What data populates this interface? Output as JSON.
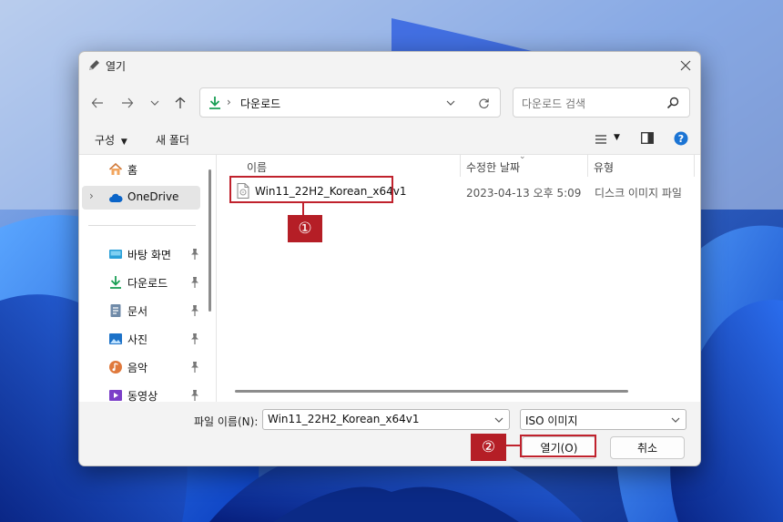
{
  "dialog": {
    "title": "열기"
  },
  "navigation": {
    "address_path": "다운로드",
    "search_placeholder": "다운로드 검색"
  },
  "commandbar": {
    "organize_label": "구성",
    "new_folder_label": "새 폴더"
  },
  "sidebar": {
    "items": [
      {
        "label": "홈",
        "icon": "home-icon"
      },
      {
        "label": "OneDrive",
        "icon": "cloud-icon"
      },
      {
        "label": "바탕 화면",
        "icon": "desktop-icon"
      },
      {
        "label": "다운로드",
        "icon": "download-icon"
      },
      {
        "label": "문서",
        "icon": "document-icon"
      },
      {
        "label": "사진",
        "icon": "picture-icon"
      },
      {
        "label": "음악",
        "icon": "music-icon"
      },
      {
        "label": "동영상",
        "icon": "video-icon"
      }
    ]
  },
  "filelist": {
    "columns": {
      "name": "이름",
      "date": "수정한 날짜",
      "type": "유형"
    },
    "rows": [
      {
        "name": "Win11_22H2_Korean_x64v1",
        "date": "2023-04-13 오후 5:09",
        "type": "디스크 이미지 파일",
        "icon": "disc-image-file-icon"
      }
    ]
  },
  "bottom": {
    "filename_label": "파일 이름(N):",
    "filename_value": "Win11_22H2_Korean_x64v1",
    "filetype_value": "ISO 이미지",
    "open_label": "열기(O)",
    "cancel_label": "취소"
  },
  "annotations": {
    "step1": "①",
    "step2": "②"
  },
  "colors": {
    "annotation_red": "#c0222d",
    "accent_blue": "#0067c0",
    "download_green": "#1a9f55"
  }
}
